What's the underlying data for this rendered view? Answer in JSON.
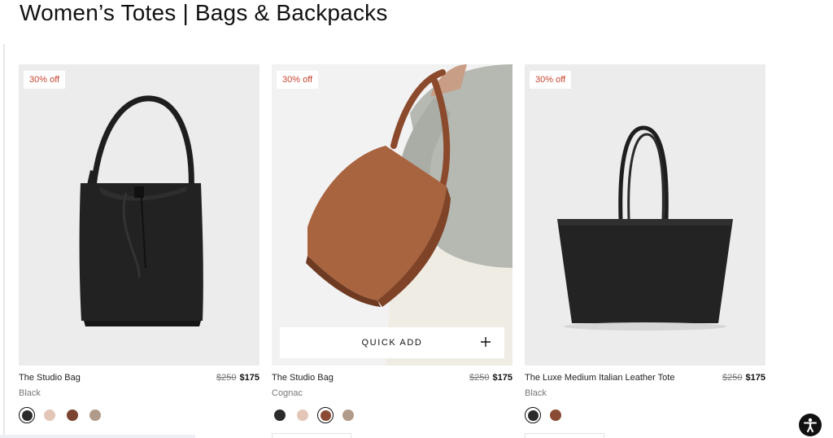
{
  "page": {
    "title": "Women’s Totes | Bags & Backpacks"
  },
  "products": [
    {
      "badge": "30% off",
      "name": "The Studio Bag",
      "color_name": "Black",
      "price_was": "$250",
      "price_now": "$175",
      "image": "black-bucket-tote-bag",
      "swatches": [
        {
          "color": "#2b2b2b",
          "selected": true
        },
        {
          "color": "#e4c6b8",
          "selected": false
        },
        {
          "color": "#7a4430",
          "selected": false
        },
        {
          "color": "#b09b8a",
          "selected": false
        }
      ]
    },
    {
      "badge": "30% off",
      "name": "The Studio Bag",
      "color_name": "Cognac",
      "price_was": "$250",
      "price_now": "$175",
      "image": "model-carrying-cognac-bag",
      "quick_add_label": "QUICK ADD",
      "swatches": [
        {
          "color": "#2b2b2b",
          "selected": false
        },
        {
          "color": "#e4c6b8",
          "selected": false
        },
        {
          "color": "#8b4a33",
          "selected": true
        },
        {
          "color": "#b09b8a",
          "selected": false
        }
      ]
    },
    {
      "badge": "30% off",
      "name": "The Luxe Medium Italian Leather Tote",
      "color_name": "Black",
      "price_was": "$250",
      "price_now": "$175",
      "image": "black-leather-tote",
      "swatches": [
        {
          "color": "#2b2b2b",
          "selected": true
        },
        {
          "color": "#8b4a33",
          "selected": false
        }
      ]
    }
  ],
  "icons": {
    "quick_add": "plus-icon",
    "accessibility": "accessibility-icon"
  },
  "colors": {
    "badge_text": "#c8452f",
    "image_bg": "#ececec"
  }
}
